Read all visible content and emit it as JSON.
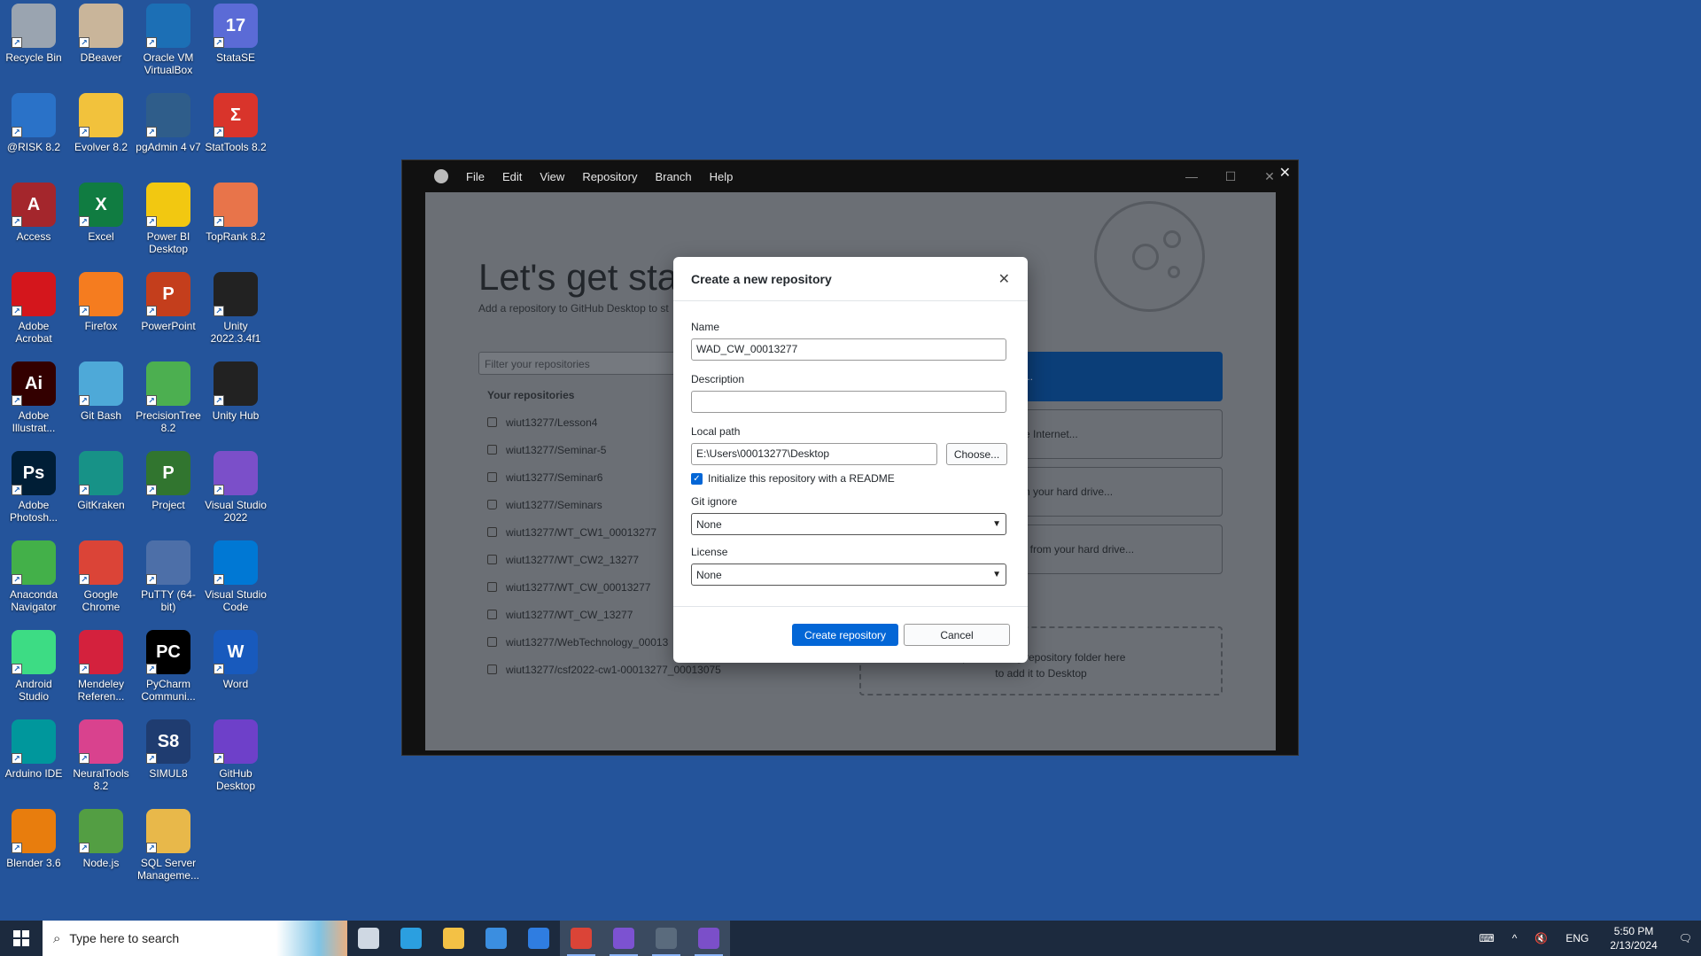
{
  "desktop_icons": [
    {
      "label": "Recycle Bin",
      "icon": "recycle-bin-icon",
      "color": "#9aa4b0"
    },
    {
      "label": "DBeaver",
      "icon": "dbeaver-icon",
      "color": "#c9b59a"
    },
    {
      "label": "Oracle VM VirtualBox",
      "icon": "virtualbox-icon",
      "color": "#1c6fb5"
    },
    {
      "label": "StataSE",
      "icon": "stata-icon",
      "color": "#5b6bd6",
      "glyph": "17"
    },
    {
      "label": "@RISK 8.2",
      "icon": "atrisk-icon",
      "color": "#2a72c8"
    },
    {
      "label": "Evolver 8.2",
      "icon": "evolver-icon",
      "color": "#f2c23c"
    },
    {
      "label": "pgAdmin 4 v7",
      "icon": "pgadmin-icon",
      "color": "#2f5d8a"
    },
    {
      "label": "StatTools 8.2",
      "icon": "stattools-icon",
      "color": "#d9342b",
      "glyph": "Σ"
    },
    {
      "label": "Access",
      "icon": "access-icon",
      "color": "#a4262c",
      "glyph": "A"
    },
    {
      "label": "Excel",
      "icon": "excel-icon",
      "color": "#107c41",
      "glyph": "X"
    },
    {
      "label": "Power BI Desktop",
      "icon": "powerbi-icon",
      "color": "#f2c811"
    },
    {
      "label": "TopRank 8.2",
      "icon": "toprank-icon",
      "color": "#e8744a"
    },
    {
      "label": "Adobe Acrobat",
      "icon": "acrobat-icon",
      "color": "#d4161c"
    },
    {
      "label": "Firefox",
      "icon": "firefox-icon",
      "color": "#f57c1f"
    },
    {
      "label": "PowerPoint",
      "icon": "powerpoint-icon",
      "color": "#c43e1c",
      "glyph": "P"
    },
    {
      "label": "Unity 2022.3.4f1",
      "icon": "unity-icon",
      "color": "#222222"
    },
    {
      "label": "Adobe Illustrat...",
      "icon": "illustrator-icon",
      "color": "#330000",
      "glyph": "Ai"
    },
    {
      "label": "Git Bash",
      "icon": "git-bash-icon",
      "color": "#4ea9d8"
    },
    {
      "label": "PrecisionTree 8.2",
      "icon": "precisiontree-icon",
      "color": "#4caf50"
    },
    {
      "label": "Unity Hub",
      "icon": "unity-hub-icon",
      "color": "#222222"
    },
    {
      "label": "Adobe Photosh...",
      "icon": "photoshop-icon",
      "color": "#001e36",
      "glyph": "Ps"
    },
    {
      "label": "GitKraken",
      "icon": "gitkraken-icon",
      "color": "#179287"
    },
    {
      "label": "Project",
      "icon": "project-icon",
      "color": "#31752f",
      "glyph": "P"
    },
    {
      "label": "Visual Studio 2022",
      "icon": "visual-studio-icon",
      "color": "#7b4fc9"
    },
    {
      "label": "Anaconda Navigator",
      "icon": "anaconda-icon",
      "color": "#43b049"
    },
    {
      "label": "Google Chrome",
      "icon": "chrome-icon",
      "color": "#db4437"
    },
    {
      "label": "PuTTY (64-bit)",
      "icon": "putty-icon",
      "color": "#4d6fa8"
    },
    {
      "label": "Visual Studio Code",
      "icon": "vscode-icon",
      "color": "#0078d4"
    },
    {
      "label": "Android Studio",
      "icon": "android-studio-icon",
      "color": "#3ddc84"
    },
    {
      "label": "Mendeley Referen...",
      "icon": "mendeley-icon",
      "color": "#d4213d"
    },
    {
      "label": "PyCharm Communi...",
      "icon": "pycharm-icon",
      "color": "#000000",
      "glyph": "PC"
    },
    {
      "label": "Word",
      "icon": "word-icon",
      "color": "#185abd",
      "glyph": "W"
    },
    {
      "label": "Arduino IDE",
      "icon": "arduino-icon",
      "color": "#00979c"
    },
    {
      "label": "NeuralTools 8.2",
      "icon": "neuraltools-icon",
      "color": "#d9428e"
    },
    {
      "label": "SIMUL8",
      "icon": "simul8-icon",
      "color": "#1f3c70",
      "glyph": "S8"
    },
    {
      "label": "GitHub Desktop",
      "icon": "github-desktop-icon",
      "color": "#6e40c9"
    },
    {
      "label": "Blender 3.6",
      "icon": "blender-icon",
      "color": "#e87d0d"
    },
    {
      "label": "Node.js",
      "icon": "nodejs-icon",
      "color": "#539e43"
    },
    {
      "label": "SQL Server Manageme...",
      "icon": "ssms-icon",
      "color": "#e8b84a"
    }
  ],
  "app_window": {
    "menu": [
      "File",
      "Edit",
      "View",
      "Repository",
      "Branch",
      "Help"
    ],
    "welcome_title": "Let's get star",
    "welcome_subtitle": "Add a repository to GitHub Desktop to st",
    "filter_placeholder": "Filter your repositories",
    "your_repositories_label": "Your repositories",
    "repositories": [
      {
        "name": "wiut13277/Lesson4",
        "locked": false
      },
      {
        "name": "wiut13277/Seminar-5",
        "locked": false
      },
      {
        "name": "wiut13277/Seminar6",
        "locked": false
      },
      {
        "name": "wiut13277/Seminars",
        "locked": true
      },
      {
        "name": "wiut13277/WT_CW1_00013277",
        "locked": false
      },
      {
        "name": "wiut13277/WT_CW2_13277",
        "locked": false
      },
      {
        "name": "wiut13277/WT_CW_00013277",
        "locked": false
      },
      {
        "name": "wiut13277/WT_CW_13277",
        "locked": false
      },
      {
        "name": "wiut13277/WebTechnology_00013",
        "locked": false
      },
      {
        "name": "wiut13277/csf2022-cw1-00013277_00013075",
        "locked": false
      }
    ],
    "right_buttons": [
      {
        "label": "..."
      },
      {
        "label": "e Internet..."
      },
      {
        "label": "n your hard drive..."
      },
      {
        "label": "/ from your hard drive..."
      }
    ],
    "drop_text_line1": "op an existing repository folder here",
    "drop_text_line2": "to add it to Desktop"
  },
  "dialog": {
    "title": "Create a new repository",
    "name_label": "Name",
    "name_value": "WAD_CW_00013277",
    "description_label": "Description",
    "description_value": "",
    "local_path_label": "Local path",
    "local_path_value": "E:\\Users\\00013277\\Desktop",
    "choose_label": "Choose...",
    "readme_label": "Initialize this repository with a README",
    "readme_checked": true,
    "gitignore_label": "Git ignore",
    "gitignore_value": "None",
    "license_label": "License",
    "license_value": "None",
    "create_label": "Create repository",
    "cancel_label": "Cancel"
  },
  "taskbar": {
    "search_placeholder": "Type here to search",
    "language": "ENG",
    "time": "5:50 PM",
    "date": "2/13/2024",
    "pinned": [
      {
        "icon": "task-view-icon",
        "color": "#cfd8e3",
        "active": false
      },
      {
        "icon": "edge-icon",
        "color": "#2b9fe0",
        "active": false
      },
      {
        "icon": "file-explorer-icon",
        "color": "#f3c145",
        "active": false
      },
      {
        "icon": "store-icon",
        "color": "#3b8ee0",
        "active": false
      },
      {
        "icon": "mail-icon",
        "color": "#2f7de1",
        "active": false
      },
      {
        "icon": "chrome-icon",
        "color": "#db4437",
        "active": true
      },
      {
        "icon": "github-desktop-icon",
        "color": "#7c52d1",
        "active": true
      },
      {
        "icon": "calculator-icon",
        "color": "#5a6b7d",
        "active": true
      },
      {
        "icon": "visual-studio-icon",
        "color": "#7b4fc9",
        "active": true
      }
    ]
  }
}
